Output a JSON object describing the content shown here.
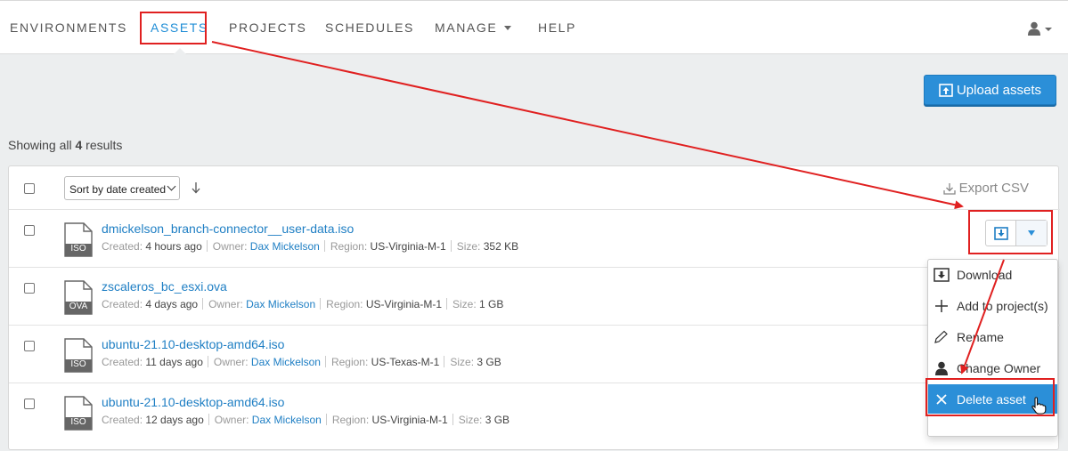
{
  "nav": {
    "items": [
      {
        "label": "ENVIRONMENTS"
      },
      {
        "label": "ASSETS"
      },
      {
        "label": "PROJECTS"
      },
      {
        "label": "SCHEDULES"
      },
      {
        "label": "MANAGE"
      },
      {
        "label": "HELP"
      }
    ]
  },
  "toolbar": {
    "upload_label": "Upload assets"
  },
  "results": {
    "prefix": "Showing all ",
    "count": "4",
    "suffix": " results"
  },
  "list": {
    "sort_label": "Sort by date created",
    "export_label": "Export CSV",
    "labels": {
      "created": "Created:",
      "owner": "Owner:",
      "region": "Region:",
      "size": "Size:"
    },
    "rows": [
      {
        "name": "dmickelson_branch-connector__user-data.iso",
        "type": "ISO",
        "created": "4 hours ago",
        "owner": "Dax Mickelson",
        "region": "US-Virginia-M-1",
        "size": "352 KB"
      },
      {
        "name": "zscaleros_bc_esxi.ova",
        "type": "OVA",
        "created": "4 days ago",
        "owner": "Dax Mickelson",
        "region": "US-Virginia-M-1",
        "size": "1 GB"
      },
      {
        "name": "ubuntu-21.10-desktop-amd64.iso",
        "type": "ISO",
        "created": "11 days ago",
        "owner": "Dax Mickelson",
        "region": "US-Texas-M-1",
        "size": "3 GB"
      },
      {
        "name": "ubuntu-21.10-desktop-amd64.iso",
        "type": "ISO",
        "created": "12 days ago",
        "owner": "Dax Mickelson",
        "region": "US-Virginia-M-1",
        "size": "3 GB"
      }
    ]
  },
  "menu": {
    "items": [
      {
        "label": "Download",
        "icon": "download-icon"
      },
      {
        "label": "Add to project(s)",
        "icon": "plus-icon"
      },
      {
        "label": "Rename",
        "icon": "pencil-icon"
      },
      {
        "label": "Change Owner",
        "icon": "user-icon"
      },
      {
        "label": "Delete asset",
        "icon": "close-icon"
      }
    ]
  },
  "colors": {
    "accent": "#2b8fd8",
    "annotation": "#e02020",
    "link": "#1f7fc4"
  }
}
